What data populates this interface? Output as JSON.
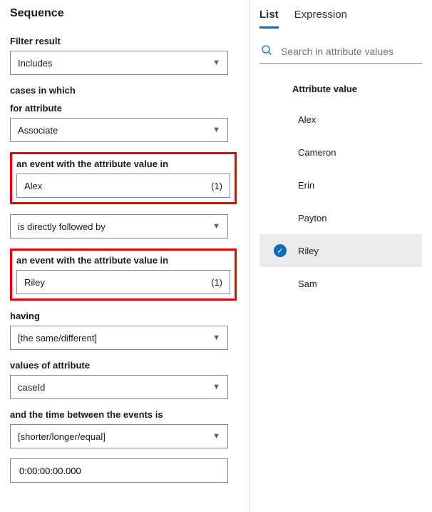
{
  "left": {
    "heading": "Sequence",
    "filterResultLabel": "Filter result",
    "filterResultValue": "Includes",
    "casesLabel": "cases in which",
    "forAttrLabel": "for attribute",
    "forAttrValue": "Associate",
    "event1Label": "an event with the attribute value in",
    "event1Value": "Alex",
    "event1Count": "(1)",
    "followedValue": "is directly followed by",
    "event2Label": "an event with the attribute value in",
    "event2Value": "Riley",
    "event2Count": "(1)",
    "havingLabel": "having",
    "havingValue": "[the same/different]",
    "valuesAttrLabel": "values of attribute",
    "valuesAttrValue": "caseId",
    "timeLabel": "and the time between the events is",
    "timeOpValue": "[shorter/longer/equal]",
    "timeInputValue": "0:00:00:00.000"
  },
  "right": {
    "tabList": "List",
    "tabExpression": "Expression",
    "searchPlaceholder": "Search in attribute values",
    "attrHeader": "Attribute value",
    "items": [
      {
        "name": "Alex",
        "selected": false
      },
      {
        "name": "Cameron",
        "selected": false
      },
      {
        "name": "Erin",
        "selected": false
      },
      {
        "name": "Payton",
        "selected": false
      },
      {
        "name": "Riley",
        "selected": true
      },
      {
        "name": "Sam",
        "selected": false
      }
    ]
  }
}
